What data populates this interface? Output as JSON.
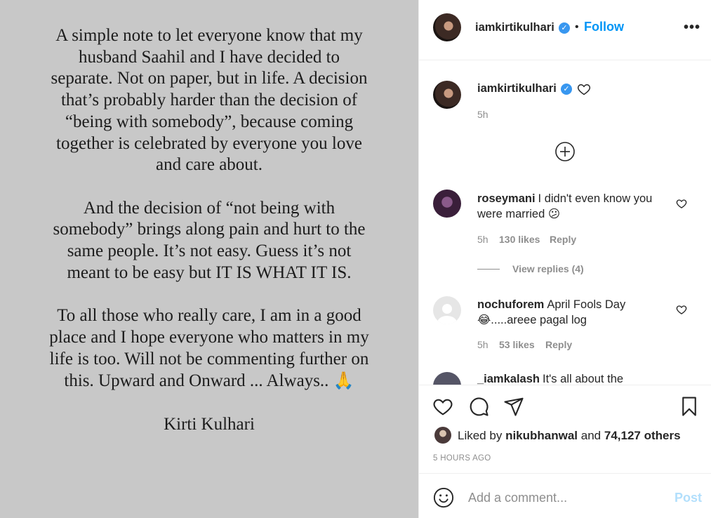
{
  "post_image": {
    "paragraphs": [
      [
        "A simple note to let everyone know that my",
        "husband Saahil and I have decided to",
        "separate. Not on paper, but in life.  A decision",
        "that’s probably harder than the decision of",
        "“being with somebody”,  because coming",
        "together is celebrated by everyone you love",
        "and care about."
      ],
      [
        "And the decision of “not being with",
        "somebody” brings along pain and hurt to the",
        "same people. It’s not easy. Guess it’s not",
        "meant to be easy but IT IS WHAT IT IS."
      ],
      [
        "To all those who really care, I am in a good",
        "place and I hope everyone who matters in my",
        "life is too. Will not be commenting further on",
        "this. Upward and Onward ... Always.. "
      ],
      [
        "Kirti Kulhari"
      ]
    ],
    "emoji": "🙏"
  },
  "header": {
    "username": "iamkirtikulhari",
    "verified_glyph": "✓",
    "dot": "•",
    "follow_label": "Follow",
    "more_label": "•••"
  },
  "caption": {
    "username": "iamkirtikulhari",
    "time": "5h"
  },
  "comments": [
    {
      "username": "roseymani",
      "text": "I didn't even know you were married 😕",
      "time": "5h",
      "likes": "130 likes",
      "reply_label": "Reply",
      "view_replies": "View replies (4)"
    },
    {
      "username": "nochuforem",
      "text": "April Fools Day 😂.....areee pagal log",
      "time": "5h",
      "likes": "53 likes",
      "reply_label": "Reply"
    },
    {
      "username": "_iamkalash",
      "text": "It's all about the"
    }
  ],
  "likes": {
    "prefix": "Liked by",
    "user": "nikubhanwal",
    "and": "and",
    "count": "74,127 others"
  },
  "time_ago": "5 HOURS AGO",
  "add_comment": {
    "placeholder": "Add a comment...",
    "post_label": "Post"
  },
  "colors": {
    "accent": "#0095f6",
    "image_bg": "#c8c8c8",
    "muted": "#8e8e8e"
  }
}
